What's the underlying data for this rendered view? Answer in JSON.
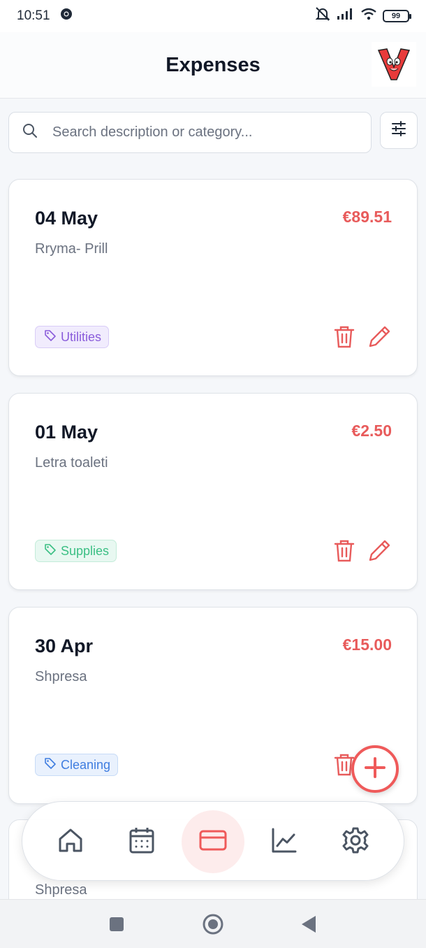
{
  "status_bar": {
    "time": "10:51",
    "battery": "99"
  },
  "header": {
    "title": "Expenses"
  },
  "search": {
    "placeholder": "Search description or category..."
  },
  "expenses": [
    {
      "date": "04 May",
      "description": "Rryma- Prill",
      "amount": "€89.51",
      "category": "Utilities"
    },
    {
      "date": "01 May",
      "description": "Letra toaleti",
      "amount": "€2.50",
      "category": "Supplies"
    },
    {
      "date": "30 Apr",
      "description": "Shpresa",
      "amount": "€15.00",
      "category": "Cleaning"
    },
    {
      "description": "Shpresa"
    }
  ],
  "nav": {
    "items": [
      "home-icon",
      "calendar-icon",
      "card-icon",
      "chart-icon",
      "settings-icon"
    ],
    "active": "card-icon"
  },
  "colors": {
    "accent": "#ef5a5a",
    "amount": "#e85b5b",
    "utilities": "#8a5cdb",
    "supplies": "#3bbf84",
    "cleaning": "#3f7de0"
  }
}
